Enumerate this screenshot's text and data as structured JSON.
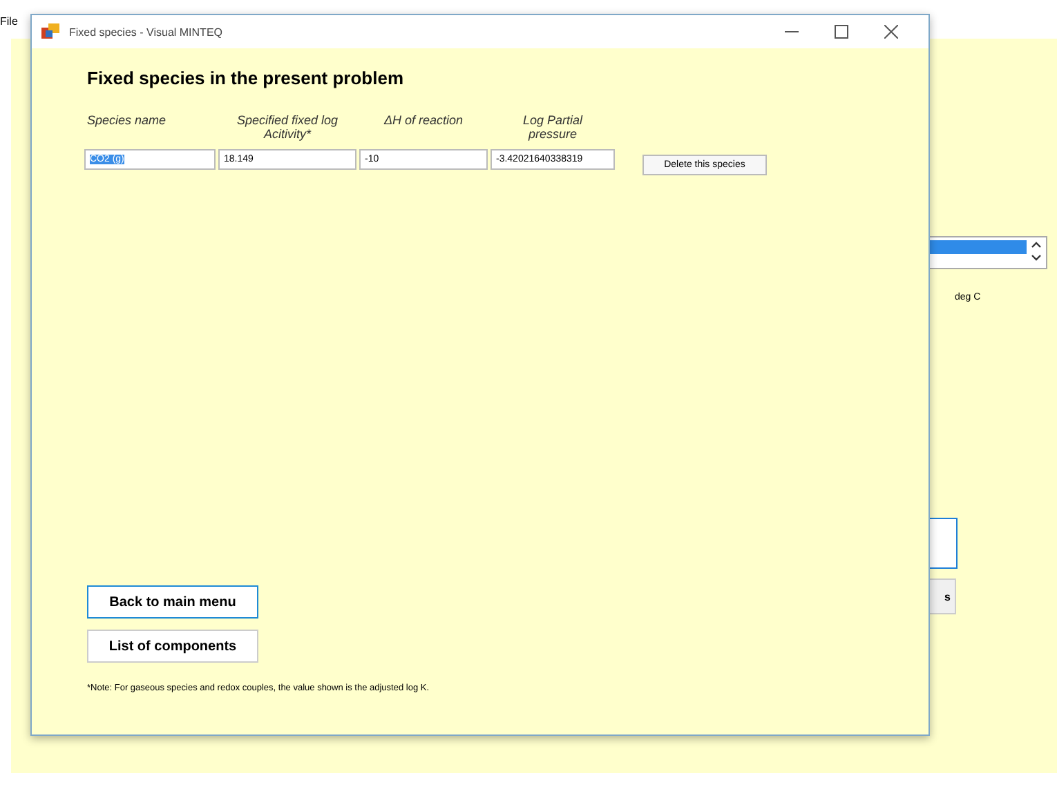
{
  "background_window": {
    "menu": [
      "File"
    ],
    "temperature_unit": "deg C",
    "partial_button": "s"
  },
  "dialog": {
    "title": "Fixed species - Visual MINTEQ",
    "heading": "Fixed species in the present problem",
    "columns": [
      "Species name",
      "Specified fixed log Acitivity*",
      "ΔH of reaction",
      "Log Partial pressure"
    ],
    "rows": [
      {
        "species_name": "CO2 (g)",
        "text_selected": true,
        "fixed_log_activity": "18.149",
        "delta_h": "-10",
        "log_partial_pressure": "-3.42021640338319",
        "action": "Delete this species"
      }
    ],
    "buttons": [
      {
        "label": "Back to main menu",
        "focused": true
      },
      {
        "label": "List of components",
        "focused": false
      }
    ],
    "note": "*Note: For gaseous species and redox couples, the value shown is the adjusted log K."
  }
}
